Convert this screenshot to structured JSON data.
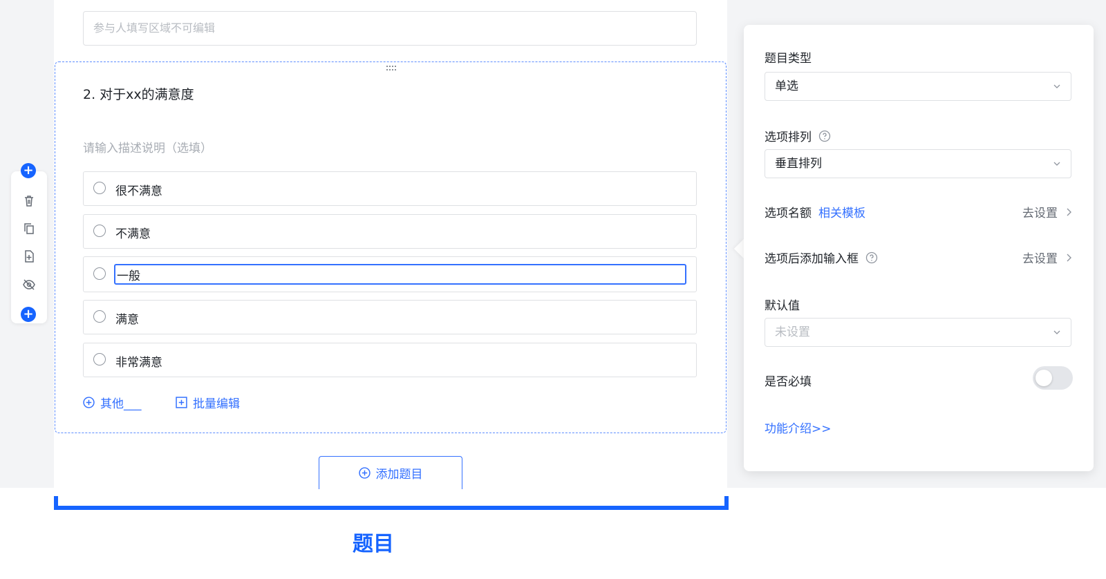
{
  "readonly_placeholder": "参与人填写区域不可编辑",
  "question": {
    "title": "2. 对于xx的满意度",
    "description_placeholder": "请输入描述说明（选填）",
    "options": [
      "很不满意",
      "不满意",
      "一般",
      "满意",
      "非常满意"
    ],
    "editing_option_index": 2,
    "add_other_label": "其他___",
    "batch_edit_label": "批量编辑"
  },
  "add_question_label": "添加题目",
  "caption": "题目",
  "panel": {
    "question_type_label": "题目类型",
    "question_type_value": "单选",
    "option_layout_label": "选项排列",
    "option_layout_value": "垂直排列",
    "option_quota_label": "选项名额",
    "option_quota_link": "相关模板",
    "go_set_label": "去设置",
    "add_input_label": "选项后添加输入框",
    "default_value_label": "默认值",
    "default_value_placeholder": "未设置",
    "required_label": "是否必填",
    "required_on": false,
    "feature_intro": "功能介绍>>"
  },
  "colors": {
    "accent": "#3370ff",
    "brand_blue": "#1664ff"
  }
}
